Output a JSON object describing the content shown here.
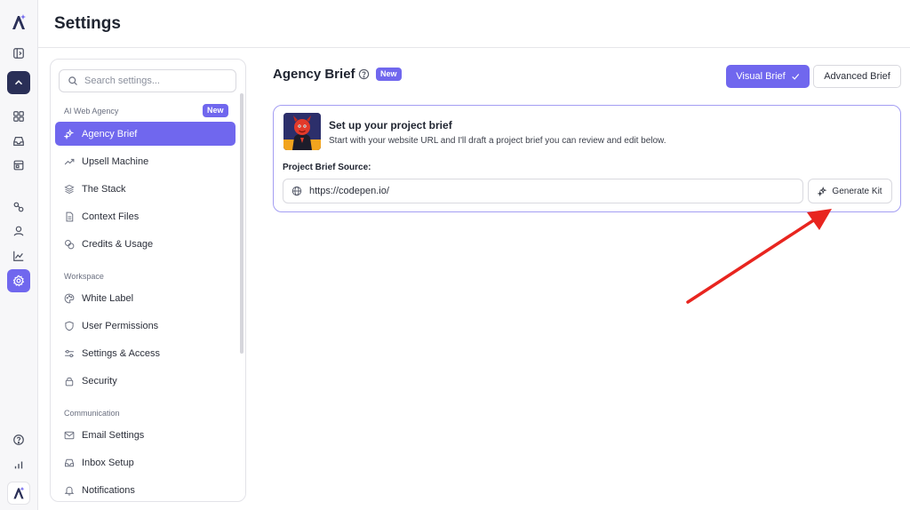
{
  "header": {
    "title": "Settings"
  },
  "search": {
    "placeholder": "Search settings..."
  },
  "nav": {
    "sections": [
      {
        "label": "AI Web Agency",
        "badge": "New"
      },
      {
        "label": "Workspace"
      },
      {
        "label": "Communication"
      }
    ],
    "items": [
      {
        "label": "Agency Brief",
        "icon": "sparkles-icon",
        "active": true
      },
      {
        "label": "Upsell Machine",
        "icon": "trend-up-icon"
      },
      {
        "label": "The Stack",
        "icon": "layers-icon"
      },
      {
        "label": "Context Files",
        "icon": "file-icon"
      },
      {
        "label": "Credits & Usage",
        "icon": "coins-icon"
      },
      {
        "label": "White Label",
        "icon": "palette-icon"
      },
      {
        "label": "User Permissions",
        "icon": "shield-icon"
      },
      {
        "label": "Settings & Access",
        "icon": "sliders-icon"
      },
      {
        "label": "Security",
        "icon": "lock-icon"
      },
      {
        "label": "Email Settings",
        "icon": "mail-icon"
      },
      {
        "label": "Inbox Setup",
        "icon": "inbox-icon"
      },
      {
        "label": "Notifications",
        "icon": "bell-icon"
      }
    ]
  },
  "main": {
    "title": "Agency Brief",
    "title_badge": "New",
    "tabs": {
      "visual": "Visual Brief",
      "advanced": "Advanced Brief"
    },
    "card": {
      "title": "Set up your project brief",
      "subtitle": "Start with your website URL and I'll draft a project brief you can review and edit below.",
      "source_label": "Project Brief Source:",
      "url_value": "https://codepen.io/",
      "generate_label": "Generate Kit"
    }
  },
  "colors": {
    "accent": "#7067ee",
    "rail_dark": "#2a2f57",
    "annotation_arrow": "#e8251f"
  }
}
